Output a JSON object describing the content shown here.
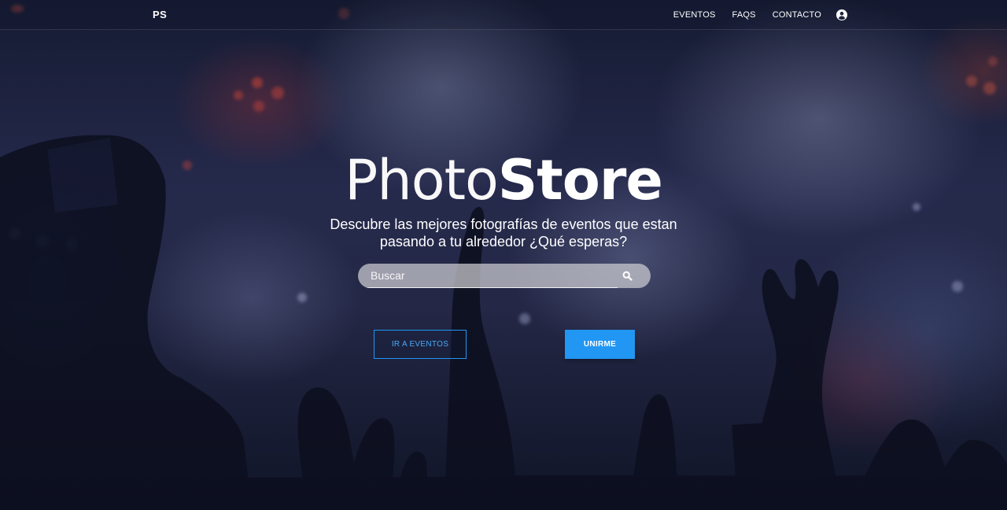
{
  "navbar": {
    "brand": "PS",
    "links": [
      {
        "label": "EVENTOS"
      },
      {
        "label": "FAQS"
      },
      {
        "label": "CONTACTO"
      }
    ],
    "account_icon": "account-circle-icon"
  },
  "hero": {
    "title_light": "Photo",
    "title_bold": "Store",
    "subtitle": "Descubre las mejores fotografías de eventos que estan pasando a tu alrededor ¿Qué esperas?",
    "search": {
      "placeholder": "Buscar",
      "value": "",
      "icon": "search-icon"
    },
    "buttons": {
      "events_label": "IR A EVENTOS",
      "join_label": "UNIRME"
    }
  },
  "colors": {
    "accent": "#2196f3",
    "text": "#ffffff"
  }
}
